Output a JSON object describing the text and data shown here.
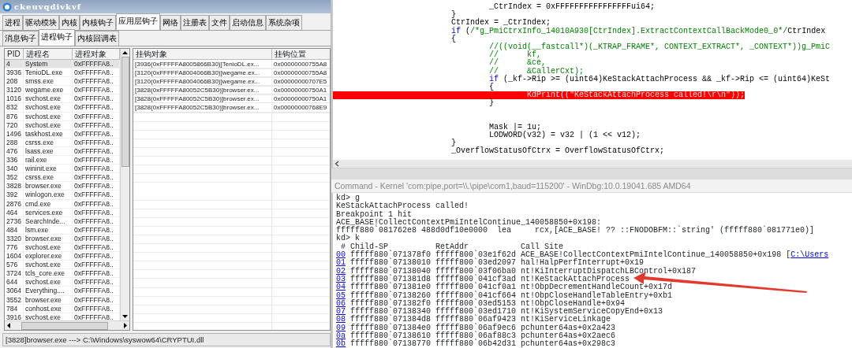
{
  "app_window": {
    "title": "ckeuvqdivkvf",
    "tabs": [
      {
        "label": "进程",
        "selected": false
      },
      {
        "label": "驱动模块",
        "selected": false
      },
      {
        "label": "内核",
        "selected": false
      },
      {
        "label": "内核钩子",
        "selected": false
      },
      {
        "label": "应用层钩子",
        "selected": true
      },
      {
        "label": "网络",
        "selected": false
      },
      {
        "label": "注册表",
        "selected": false
      },
      {
        "label": "文件",
        "selected": false
      },
      {
        "label": "启动信息",
        "selected": false
      },
      {
        "label": "系统杂项",
        "selected": false
      }
    ],
    "sub_tabs": [
      {
        "label": "消息钩子",
        "selected": false
      },
      {
        "label": "进程钩子",
        "selected": true
      },
      {
        "label": "内核回调表",
        "selected": false
      }
    ],
    "process_table": {
      "columns": [
        "PID",
        "进程名",
        "进程对象"
      ],
      "rows": [
        {
          "pid": "4",
          "name": "System",
          "object": "0xFFFFFA8..",
          "selected": true
        },
        {
          "pid": "3936",
          "name": "TenioDL.exe",
          "object": "0xFFFFFA8..",
          "selected": false
        },
        {
          "pid": "208",
          "name": "smss.exe",
          "object": "0xFFFFFA8..",
          "selected": false
        },
        {
          "pid": "3120",
          "name": "wegame.exe",
          "object": "0xFFFFFA8..",
          "selected": false
        },
        {
          "pid": "1016",
          "name": "svchost.exe",
          "object": "0xFFFFFA8..",
          "selected": false
        },
        {
          "pid": "832",
          "name": "svchost.exe",
          "object": "0xFFFFFA8..",
          "selected": false
        },
        {
          "pid": "876",
          "name": "svchost.exe",
          "object": "0xFFFFFA8..",
          "selected": false
        },
        {
          "pid": "720",
          "name": "svchost.exe",
          "object": "0xFFFFFA8..",
          "selected": false
        },
        {
          "pid": "1496",
          "name": "taskhost.exe",
          "object": "0xFFFFFA8..",
          "selected": false
        },
        {
          "pid": "288",
          "name": "csrss.exe",
          "object": "0xFFFFFA8..",
          "selected": false
        },
        {
          "pid": "476",
          "name": "lsass.exe",
          "object": "0xFFFFFA8..",
          "selected": false
        },
        {
          "pid": "336",
          "name": "rail.exe",
          "object": "0xFFFFFA8..",
          "selected": false
        },
        {
          "pid": "340",
          "name": "wininit.exe",
          "object": "0xFFFFFA8..",
          "selected": false
        },
        {
          "pid": "352",
          "name": "csrss.exe",
          "object": "0xFFFFFA8..",
          "selected": false
        },
        {
          "pid": "3828",
          "name": "browser.exe",
          "object": "0xFFFFFA8..",
          "selected": false
        },
        {
          "pid": "392",
          "name": "winlogon.exe",
          "object": "0xFFFFFA8..",
          "selected": false
        },
        {
          "pid": "2876",
          "name": "cmd.exe",
          "object": "0xFFFFFA8..",
          "selected": false
        },
        {
          "pid": "464",
          "name": "services.exe",
          "object": "0xFFFFFA8..",
          "selected": false
        },
        {
          "pid": "2736",
          "name": "SearchInde...",
          "object": "0xFFFFFA8..",
          "selected": false
        },
        {
          "pid": "484",
          "name": "lsm.exe",
          "object": "0xFFFFFA8..",
          "selected": false
        },
        {
          "pid": "3320",
          "name": "browser.exe",
          "object": "0xFFFFFA8..",
          "selected": false
        },
        {
          "pid": "776",
          "name": "svchost.exe",
          "object": "0xFFFFFA8..",
          "selected": false
        },
        {
          "pid": "1604",
          "name": "explorer.exe",
          "object": "0xFFFFFA8..",
          "selected": false
        },
        {
          "pid": "576",
          "name": "svchost.exe",
          "object": "0xFFFFFA8..",
          "selected": false
        },
        {
          "pid": "3724",
          "name": "tcls_core.exe",
          "object": "0xFFFFFA8..",
          "selected": false
        },
        {
          "pid": "644",
          "name": "svchost.exe",
          "object": "0xFFFFFA8..",
          "selected": false
        },
        {
          "pid": "3064",
          "name": "Everything....",
          "object": "0xFFFFFA8..",
          "selected": false
        },
        {
          "pid": "3552",
          "name": "browser.exe",
          "object": "0xFFFFFA8..",
          "selected": false
        },
        {
          "pid": "784",
          "name": "conhost.exe",
          "object": "0xFFFFFA8..",
          "selected": false
        },
        {
          "pid": "3916",
          "name": "svchost.exe",
          "object": "0xFFFFFA8..",
          "selected": false
        }
      ]
    },
    "hook_table": {
      "columns": [
        "挂钩对象",
        "挂钩位置"
      ],
      "rows": [
        {
          "hook_object": "[3936(0xFFFFFA8005866B30)]TenioDL.ex...",
          "hook_address": "0x00000000755A8"
        },
        {
          "hook_object": "[3120(0xFFFFFA8004066B30)]wegame.ex...",
          "hook_address": "0x00000000755A8"
        },
        {
          "hook_object": "[3120(0xFFFFFA8004066B30)]wegame.ex...",
          "hook_address": "0x00000000707E5"
        },
        {
          "hook_object": "[3828(0xFFFFFA80052C5B30)]browser.ex...",
          "hook_address": "0x00000000750A1"
        },
        {
          "hook_object": "[3828(0xFFFFFA80052C5B30)]browser.ex...",
          "hook_address": "0x00000000750A1"
        },
        {
          "hook_object": "[3828(0xFFFFFA80052C5B30)]browser.ex...",
          "hook_address": "0x00000000768E9"
        }
      ]
    },
    "status_bar": "[3828]browser.exe ---> C:\\Windows\\syswow64\\CRYPTUI.dll"
  },
  "code_view": {
    "lines": [
      {
        "kind": "code",
        "highlighted": false,
        "parts": [
          {
            "kind": "plain",
            "text": "\t\t\t\t_CtrIndex = 0xFFFFFFFFFFFFFFFFui64;"
          }
        ]
      },
      {
        "kind": "code",
        "highlighted": false,
        "parts": [
          {
            "kind": "plain",
            "text": "\t\t\t}"
          }
        ]
      },
      {
        "kind": "code",
        "highlighted": false,
        "parts": [
          {
            "kind": "plain",
            "text": "\t\t\tCtrIndex = _CtrIndex;"
          }
        ]
      },
      {
        "kind": "code",
        "highlighted": false,
        "parts": [
          {
            "kind": "keyword",
            "text": "\t\t\tif"
          },
          {
            "kind": "plain",
            "text": " ("
          },
          {
            "kind": "comment",
            "text": "/*g_PmiCtrxInfo_14010A930[CtrIndex].ExtractContextCallBackMode0_0*/"
          },
          {
            "kind": "plain",
            "text": "CtrIndex"
          }
        ]
      },
      {
        "kind": "code",
        "highlighted": false,
        "parts": [
          {
            "kind": "plain",
            "text": "\t\t\t{"
          }
        ]
      },
      {
        "kind": "code",
        "highlighted": false,
        "parts": [
          {
            "kind": "comment",
            "text": "\t\t\t\t//((void(__fastcall*)(_KTRAP_FRAME*, CONTEXT_EXTRACT*, _CONTEXT*))g_PmiC"
          }
        ]
      },
      {
        "kind": "code",
        "highlighted": false,
        "parts": [
          {
            "kind": "comment",
            "text": "\t\t\t\t//\tkf,"
          }
        ]
      },
      {
        "kind": "code",
        "highlighted": false,
        "parts": [
          {
            "kind": "comment",
            "text": "\t\t\t\t//\t&ce,"
          }
        ]
      },
      {
        "kind": "code",
        "highlighted": false,
        "parts": [
          {
            "kind": "comment",
            "text": "\t\t\t\t//\t&CallerCxt);"
          }
        ]
      },
      {
        "kind": "code",
        "highlighted": false,
        "parts": [
          {
            "kind": "keyword",
            "text": "\t\t\t\tif"
          },
          {
            "kind": "plain",
            "text": " (_kf->Rip >= (uint64)KeStackAttachProcess && _kf->Rip <= (uint64)KeSt"
          }
        ]
      },
      {
        "kind": "code",
        "highlighted": false,
        "parts": [
          {
            "kind": "plain",
            "text": "\t\t\t\t{"
          }
        ]
      },
      {
        "kind": "code",
        "highlighted": true,
        "parts": [
          {
            "kind": "plain",
            "text": "\t\t\t\t\tKdPrint((\"KeStackAttachProcess called!\\r\\n\"));"
          }
        ]
      },
      {
        "kind": "code",
        "highlighted": false,
        "parts": [
          {
            "kind": "plain",
            "text": "\t\t\t\t}"
          }
        ]
      },
      {
        "kind": "blank",
        "highlighted": false
      },
      {
        "kind": "blank",
        "highlighted": false
      },
      {
        "kind": "code",
        "highlighted": false,
        "parts": [
          {
            "kind": "plain",
            "text": "\t\t\t\tMask |= 1u;"
          }
        ]
      },
      {
        "kind": "code",
        "highlighted": false,
        "parts": [
          {
            "kind": "plain",
            "text": "\t\t\t\tLODWORD(v32) = v32 | (1 << v12);"
          }
        ]
      },
      {
        "kind": "code",
        "highlighted": false,
        "parts": [
          {
            "kind": "plain",
            "text": "\t\t\t}"
          }
        ]
      },
      {
        "kind": "code",
        "highlighted": false,
        "parts": [
          {
            "kind": "plain",
            "text": "\t\t\t_OverflowStatusOfCtrx = OverflowStatusOfCtrx;"
          }
        ]
      }
    ]
  },
  "debugger": {
    "title": "Command - Kernel 'com:pipe,port=\\\\.\\pipe\\com1,baud=115200' - WinDbg:10.0.19041.685 AMD64",
    "output": [
      "kd> g",
      "KeStackAttachProcess called!",
      "Breakpoint 1 hit",
      "ACE_BASE!CollectContextPmiIntelContinue_140058850+0x198:",
      "fffff880`081762e8 488d0df10e0000  lea     rcx,[ACE_BASE! ?? ::FNODOBFM::`string' (fffff880`081771e0)]",
      "kd> k",
      " # Child-SP          RetAddr           Call Site"
    ],
    "frames": [
      {
        "number": "00",
        "child_sp": "fffff880`071378f0",
        "ret_addr": "fffff800`03e1f62d",
        "call_site": "ACE_BASE!CollectContextPmiIntelContinue_140058850+0x198 [",
        "source": "C:\\Users"
      },
      {
        "number": "01",
        "child_sp": "fffff880`07138010",
        "ret_addr": "fffff800`03ed2097",
        "call_site": "hal!HalpPerfInterrupt+0x19"
      },
      {
        "number": "02",
        "child_sp": "fffff880`07138040",
        "ret_addr": "fffff800`03f06ba0",
        "call_site": "nt!KiInterruptDispatchLBControl+0x187"
      },
      {
        "number": "03",
        "child_sp": "fffff880`071381d8",
        "ret_addr": "fffff800`041cf3ad",
        "call_site": "nt!KeStackAttachProcess"
      },
      {
        "number": "04",
        "child_sp": "fffff880`071381e0",
        "ret_addr": "fffff800`041cf0a1",
        "call_site": "nt!ObpDecrementHandleCount+0x17d"
      },
      {
        "number": "05",
        "child_sp": "fffff880`07138260",
        "ret_addr": "fffff800`041cf664",
        "call_site": "nt!ObpCloseHandleTableEntry+0xb1"
      },
      {
        "number": "06",
        "child_sp": "fffff880`071382f0",
        "ret_addr": "fffff800`03ed5153",
        "call_site": "nt!ObpCloseHandle+0x94"
      },
      {
        "number": "07",
        "child_sp": "fffff880`07138340",
        "ret_addr": "fffff800`03ed1710",
        "call_site": "nt!KiSystemServiceCopyEnd+0x13"
      },
      {
        "number": "08",
        "child_sp": "fffff880`071384d8",
        "ret_addr": "fffff880`06af9423",
        "call_site": "nt!KiServiceLinkage"
      },
      {
        "number": "09",
        "child_sp": "fffff880`071384e0",
        "ret_addr": "fffff880`06af9ec6",
        "call_site": "pchunter64as+0x2a423"
      },
      {
        "number": "0a",
        "child_sp": "fffff880`07138610",
        "ret_addr": "fffff880`06af88c3",
        "call_site": "pchunter64as+0x2aec6"
      },
      {
        "number": "0b",
        "child_sp": "fffff880`07138770",
        "ret_addr": "fffff880`06b42d31",
        "call_site": "pchunter64as+0x298c3"
      }
    ]
  }
}
